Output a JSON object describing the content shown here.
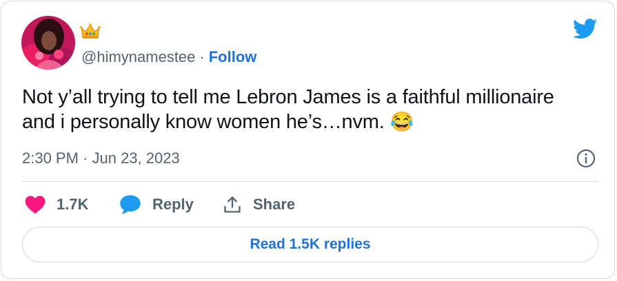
{
  "author": {
    "handle": "@himynamestee",
    "separator": "·",
    "follow_label": "Follow",
    "badge": "crown-emoji"
  },
  "tweet": {
    "text": "Not y’all trying to tell me Lebron James is a faithful millionaire and i personally know women he’s…nvm.",
    "emoji": "😂",
    "timestamp": "2:30 PM · Jun 23, 2023"
  },
  "actions": {
    "like_count": "1.7K",
    "reply_label": "Reply",
    "share_label": "Share"
  },
  "read_replies_label": "Read 1.5K replies",
  "colors": {
    "accent": "#1d72d8",
    "twitter_blue": "#1d9bf0",
    "like": "#f91880",
    "muted": "#536471",
    "border": "#cfd9de"
  },
  "icons": [
    "twitter-bird-icon",
    "info-icon",
    "heart-icon",
    "reply-bubble-icon",
    "share-icon",
    "crown-emoji"
  ]
}
